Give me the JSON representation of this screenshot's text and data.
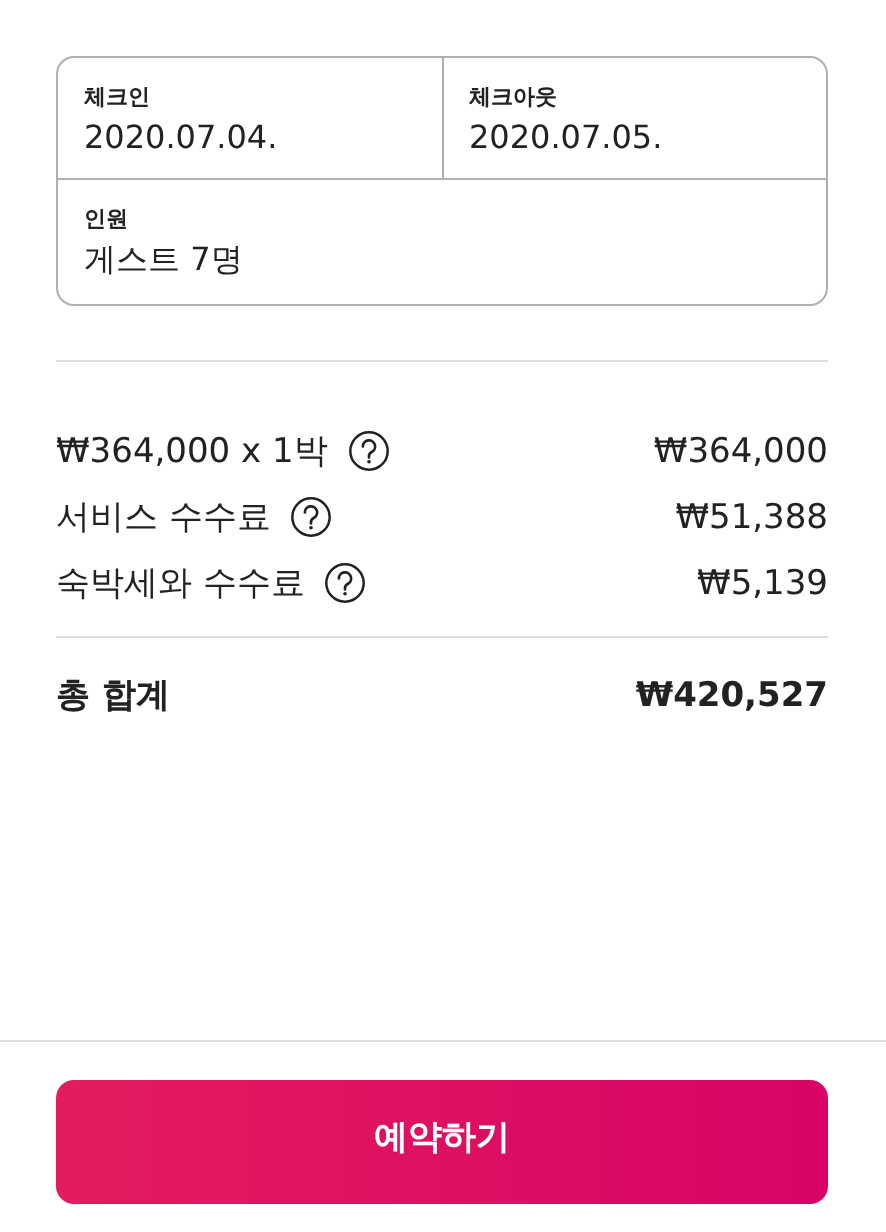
{
  "booking": {
    "check_in": {
      "label": "체크인",
      "value": "2020.07.04."
    },
    "check_out": {
      "label": "체크아웃",
      "value": "2020.07.05."
    },
    "guests": {
      "label": "인원",
      "value": "게스트 7명"
    }
  },
  "price_lines": [
    {
      "label": "₩364,000 x 1박",
      "amount": "₩364,000",
      "help": true
    },
    {
      "label": "서비스 수수료",
      "amount": "₩51,388",
      "help": true
    },
    {
      "label": "숙박세와 수수료",
      "amount": "₩5,139",
      "help": true
    }
  ],
  "total": {
    "label": "총 합계",
    "amount": "₩420,527"
  },
  "reserve_button": "예약하기"
}
